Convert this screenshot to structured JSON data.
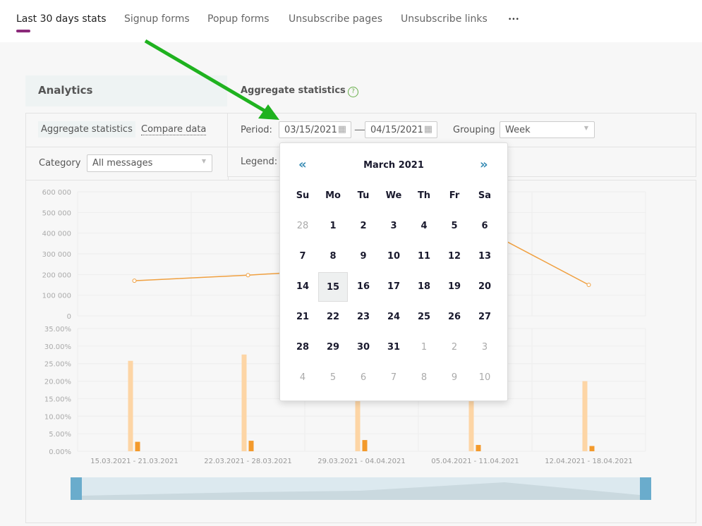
{
  "tabs": [
    {
      "label": "Last 30 days stats",
      "active": true
    },
    {
      "label": "Signup forms"
    },
    {
      "label": "Popup forms"
    },
    {
      "label": "Unsubscribe pages"
    },
    {
      "label": "Unsubscribe links"
    },
    {
      "label": "•••"
    }
  ],
  "sidebar": {
    "title": "Analytics",
    "mode_aggregate": "Aggregate statistics",
    "mode_compare": "Compare data",
    "category_label": "Category",
    "category_value": "All messages"
  },
  "main": {
    "title": "Aggregate statistics",
    "help_icon": "?",
    "period_label": "Period:",
    "date_from": "03/15/2021",
    "date_sep": "—",
    "date_to": "04/15/2021",
    "grouping_label": "Grouping",
    "grouping_value": "Week",
    "legend_label": "Legend:"
  },
  "calendar": {
    "prev": "«",
    "next": "»",
    "title": "March 2021",
    "weekdays": [
      "Su",
      "Mo",
      "Tu",
      "We",
      "Th",
      "Fr",
      "Sa"
    ],
    "days": [
      [
        "28",
        true
      ],
      [
        "1"
      ],
      [
        "2"
      ],
      [
        "3"
      ],
      [
        "4"
      ],
      [
        "5"
      ],
      [
        "6"
      ],
      [
        "7"
      ],
      [
        "8"
      ],
      [
        "9"
      ],
      [
        "10"
      ],
      [
        "11"
      ],
      [
        "12"
      ],
      [
        "13"
      ],
      [
        "14"
      ],
      [
        "15",
        false,
        true
      ],
      [
        "16"
      ],
      [
        "17"
      ],
      [
        "18"
      ],
      [
        "19"
      ],
      [
        "20"
      ],
      [
        "21"
      ],
      [
        "22"
      ],
      [
        "23"
      ],
      [
        "24"
      ],
      [
        "25"
      ],
      [
        "26"
      ],
      [
        "27"
      ],
      [
        "28"
      ],
      [
        "29"
      ],
      [
        "30"
      ],
      [
        "31"
      ],
      [
        "1",
        true
      ],
      [
        "2",
        true
      ],
      [
        "3",
        true
      ],
      [
        "4",
        true
      ],
      [
        "5",
        true
      ],
      [
        "6",
        true
      ],
      [
        "7",
        true
      ],
      [
        "8",
        true
      ],
      [
        "9",
        true
      ],
      [
        "10",
        true
      ]
    ],
    "selected": "15"
  },
  "chart_data": [
    {
      "type": "line",
      "categories": [
        "15.03.2021 - 21.03.2021",
        "22.03.2021 - 28.03.2021",
        "29.03.2021 - 04.04.2021",
        "05.04.2021 - 11.04.2021",
        "12.04.2021 - 18.04.2021"
      ],
      "yticks": [
        "0",
        "100 000",
        "200 000",
        "300 000",
        "400 000",
        "500 000",
        "600 000"
      ],
      "ylim": [
        0,
        600000
      ],
      "values": [
        170000,
        197000,
        230000,
        440000,
        150000
      ],
      "color": "#f0a040"
    },
    {
      "type": "bar",
      "categories": [
        "15.03.2021 - 21.03.2021",
        "22.03.2021 - 28.03.2021",
        "29.03.2021 - 04.04.2021",
        "05.04.2021 - 11.04.2021",
        "12.04.2021 - 18.04.2021"
      ],
      "yticks": [
        "0.00%",
        "5.00%",
        "10.00%",
        "15.00%",
        "20.00%",
        "25.00%",
        "30.00%",
        "35.00%"
      ],
      "ylim": [
        0,
        35
      ],
      "series": [
        {
          "values": [
            25.8,
            27.6,
            27,
            26,
            20.0
          ],
          "color": "#fdd5a5"
        },
        {
          "values": [
            2.7,
            3.0,
            3.2,
            1.8,
            1.5
          ],
          "color": "#f39a2c"
        }
      ]
    }
  ],
  "colors": {
    "accent": "#8b2a7a",
    "arrow": "#1fb21f",
    "navigator": "#6aaccc"
  }
}
